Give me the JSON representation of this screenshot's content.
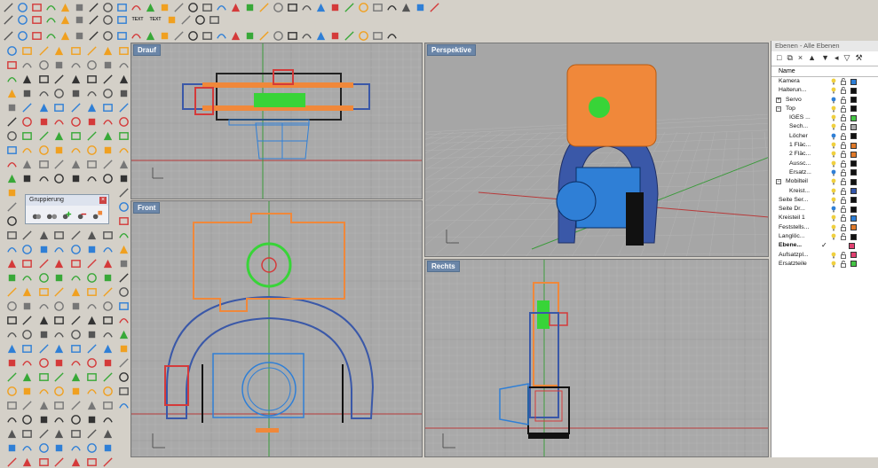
{
  "toolbars": {
    "row1_icons": [
      "line-icon",
      "polyline-icon",
      "curve-icon",
      "arc-icon",
      "circle-icon",
      "ellipse-icon",
      "polygon-icon",
      "rectangle-icon",
      "spline-icon",
      "fillet-icon",
      "offset-icon",
      "trim-icon",
      "split-icon",
      "extend-icon",
      "join-icon",
      "explode-icon",
      "group-icon",
      "ungroup-icon",
      "point-icon",
      "text-icon",
      "dimension-icon",
      "leader-icon",
      "hatch-icon",
      "block-icon",
      "insert-icon",
      "analyze-icon",
      "render-icon",
      "pan-icon",
      "rotate-icon",
      "zoom-icon",
      "undo-icon"
    ],
    "row2_icons": [
      "snap-icon",
      "grid-icon",
      "ortho-icon",
      "planar-icon",
      "osnap-icon",
      "smarttrack-icon",
      "gumball-icon",
      "record-icon",
      "filter-icon",
      "text-icon",
      "text-icon",
      "layout-icon",
      "mesh-icon",
      "analysis-icon",
      "sphere-icon"
    ],
    "row2_text_labels": [
      "TEXT",
      "TEXT"
    ],
    "row3_icons": [
      "new-file-icon",
      "open-folder-icon",
      "save-icon",
      "print-icon",
      "import-icon",
      "cut-icon",
      "copy-icon",
      "paste-icon",
      "undo-icon",
      "pan-hand-icon",
      "zoom-icon",
      "zoom-window-icon",
      "zoom-extents-icon",
      "zoom-selected-icon",
      "rotate-view-icon",
      "viewports-icon",
      "car-icon",
      "cplane-icon",
      "object-properties-icon",
      "light-icon",
      "layers-icon",
      "material-icon",
      "render-sphere-icon",
      "render-icon",
      "color-wheel-icon",
      "settings-icon",
      "hatch-icon",
      "help-icon"
    ]
  },
  "viewports": {
    "top": {
      "title": "Drauf"
    },
    "perspective": {
      "title": "Perspektive"
    },
    "front": {
      "title": "Front"
    },
    "right": {
      "title": "Rechts"
    }
  },
  "group_panel": {
    "title": "Gruppierung",
    "close": "×"
  },
  "layers_panel": {
    "title": "Ebenen - Alle Ebenen",
    "toolbar_icons": [
      "new-layer-icon",
      "new-sublayer-icon",
      "delete-icon",
      "move-up-icon",
      "move-down-icon",
      "move-left-icon",
      "filter-icon",
      "tools-icon"
    ],
    "column_name": "Name",
    "rows": [
      {
        "name": "Kamera",
        "indent": 1,
        "color": "#2c7ed6"
      },
      {
        "name": "Halterun...",
        "indent": 1,
        "color": "#111111"
      },
      {
        "name": "Servo",
        "indent": 0,
        "toggle": "+",
        "color": "#111111"
      },
      {
        "name": "Top",
        "indent": 0,
        "toggle": "−",
        "color": "#111111"
      },
      {
        "name": "IGES ...",
        "indent": 2,
        "color": "#44c444"
      },
      {
        "name": "Sech...",
        "indent": 2,
        "color": "#aaaaaa"
      },
      {
        "name": "Löcher",
        "indent": 2,
        "color": "#111111"
      },
      {
        "name": "1 Fläc...",
        "indent": 2,
        "color": "#e07a2a"
      },
      {
        "name": "2 Fläc...",
        "indent": 2,
        "color": "#e07a2a"
      },
      {
        "name": "Aussc...",
        "indent": 2,
        "color": "#111111"
      },
      {
        "name": "Ersatz...",
        "indent": 2,
        "color": "#111111"
      },
      {
        "name": "Mobilteil",
        "indent": 0,
        "toggle": "−",
        "color": "#111111"
      },
      {
        "name": "Kreist...",
        "indent": 2,
        "color": "#3355aa"
      },
      {
        "name": "Seite Ser...",
        "indent": 1,
        "color": "#111111"
      },
      {
        "name": "Seite Dr...",
        "indent": 1,
        "color": "#111111"
      },
      {
        "name": "Kreisteil 1",
        "indent": 1,
        "color": "#2c7ed6"
      },
      {
        "name": "Feststells...",
        "indent": 1,
        "color": "#e07a2a"
      },
      {
        "name": "Langlöc...",
        "indent": 1,
        "color": "#111111"
      },
      {
        "name": "Ebene...",
        "indent": 1,
        "color": "#e04070",
        "current": true,
        "check": "✓"
      },
      {
        "name": "Aufsatzpl...",
        "indent": 1,
        "color": "#e04070"
      },
      {
        "name": "Ersatzteile",
        "indent": 1,
        "color": "#44c444"
      }
    ]
  },
  "colors": {
    "viewport_bg": "#a9a9a9",
    "grid_minor": "#b6b6b6",
    "grid_major": "#9a9a9a",
    "axis_x": "#b83a3a",
    "axis_y": "#3a9a3a",
    "bracket_orange": "#f0883a",
    "arc_blue": "#3a58a8",
    "camera_blue": "#2f7fd6",
    "accent_red": "#d43a3a",
    "accent_green": "#38d438"
  }
}
